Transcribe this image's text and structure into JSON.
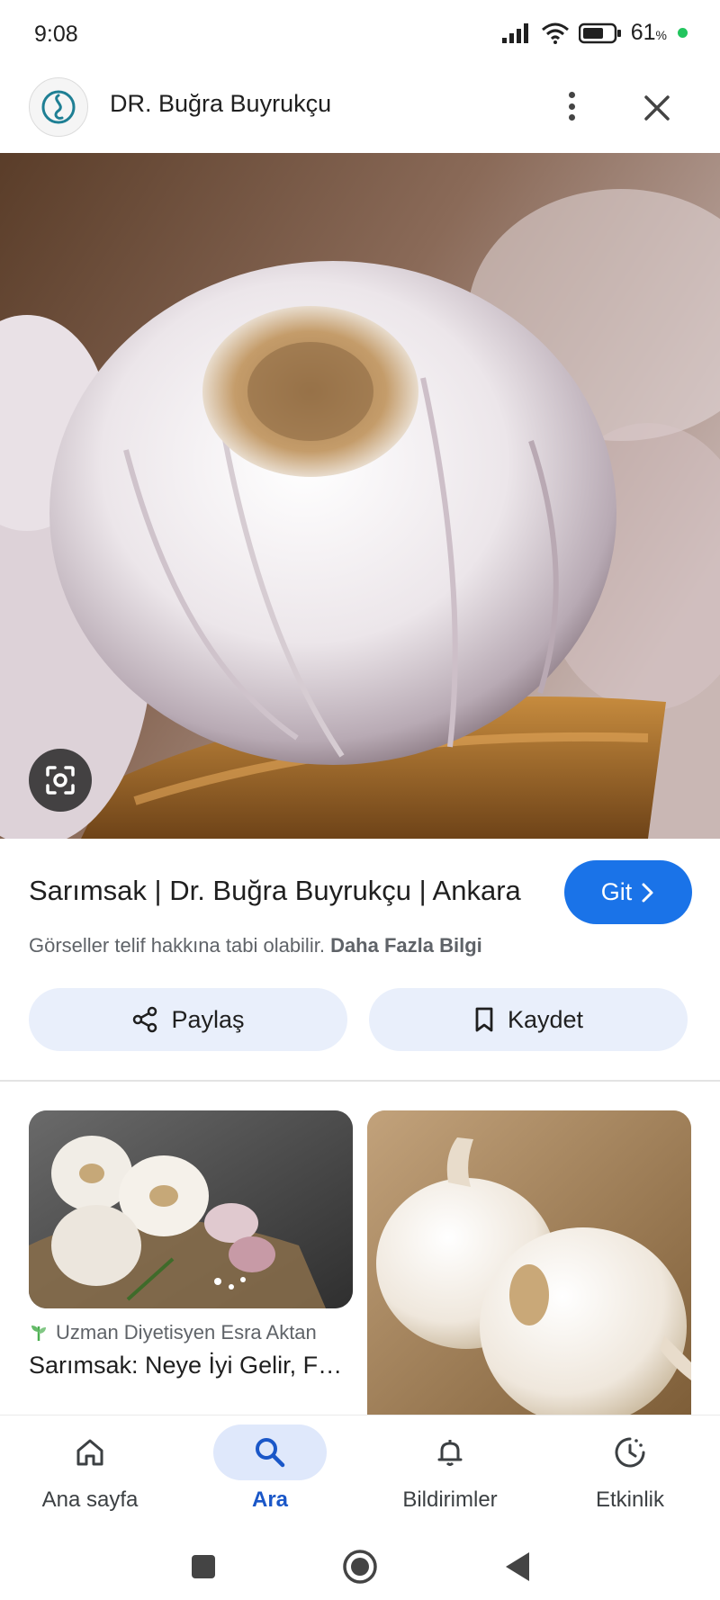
{
  "status_bar": {
    "time": "9:08",
    "battery_percent": "61",
    "battery_suffix": "%"
  },
  "header": {
    "site_name": "DR. Buğra Buyrukçu"
  },
  "result": {
    "title": "Sarımsak | Dr. Buğra Buyrukçu | Ankara",
    "go_label": "Git",
    "copyright_text": "Görseller telif hakkına tabi olabilir.",
    "more_info_label": "Daha Fazla Bilgi",
    "share_label": "Paylaş",
    "save_label": "Kaydet"
  },
  "related": [
    {
      "source": "Uzman Diyetisyen Esra Aktan",
      "title": "Sarımsak: Neye İyi Gelir, Faydaları ve Kullanımı"
    }
  ],
  "bottom_nav": [
    {
      "label": "Ana sayfa",
      "icon": "home-icon",
      "active": false
    },
    {
      "label": "Ara",
      "icon": "search-icon",
      "active": true
    },
    {
      "label": "Bildirimler",
      "icon": "bell-icon",
      "active": false
    },
    {
      "label": "Etkinlik",
      "icon": "activity-icon",
      "active": false
    }
  ],
  "colors": {
    "accent": "#1a73e8",
    "pill_bg": "#e9effb",
    "active_nav_bg": "#dfe8fb"
  }
}
